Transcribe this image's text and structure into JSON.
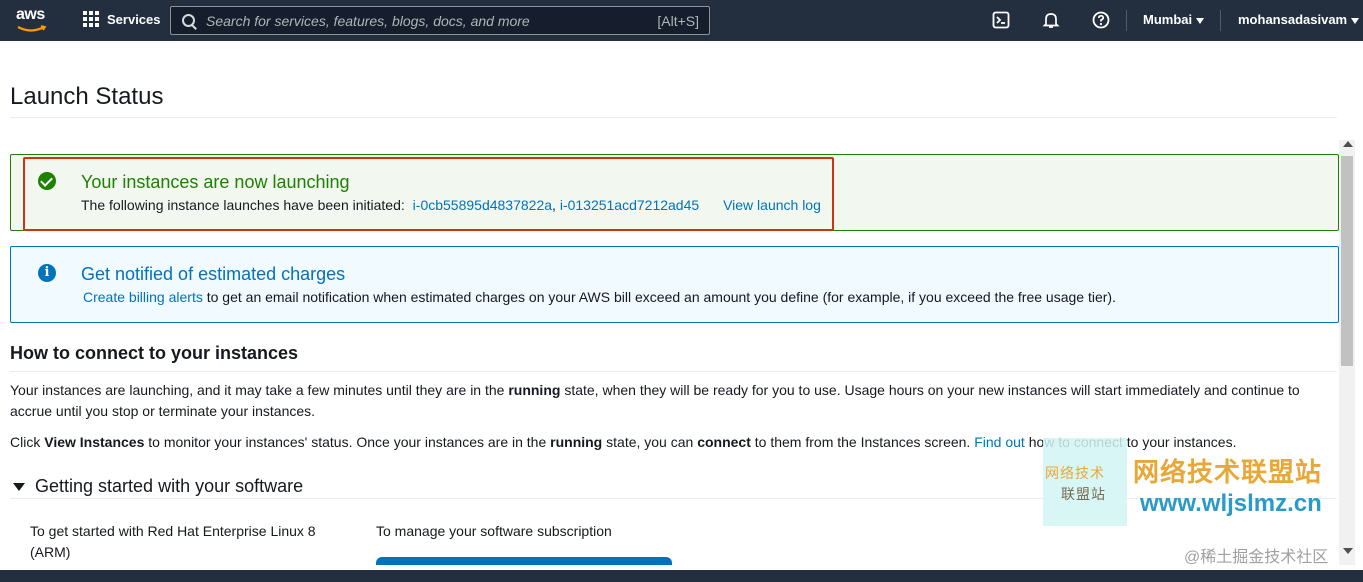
{
  "nav": {
    "logo": "aws",
    "services_label": "Services",
    "search_placeholder": "Search for services, features, blogs, docs, and more",
    "search_shortcut": "[Alt+S]",
    "region": "Mumbai",
    "account": "mohansadasivam"
  },
  "page": {
    "title": "Launch Status"
  },
  "success": {
    "title": "Your instances are now launching",
    "text": "The following instance launches have been initiated:",
    "instance1": "i-0cb55895d4837822a",
    "separator": ",",
    "instance2": "i-013251acd7212ad45",
    "log_link": "View launch log"
  },
  "info": {
    "title": "Get notified of estimated charges",
    "link": "Create billing alerts",
    "text": "to get an email notification when estimated charges on your AWS bill exceed an amount you define (for example, if you exceed the free usage tier)."
  },
  "connect": {
    "heading": "How to connect to your instances",
    "p1_a": "Your instances are launching, and it may take a few minutes until they are in the ",
    "p1_b": "running",
    "p1_c": " state, when they will be ready for you to use. Usage hours on your new instances will start immediately and continue to accrue until you stop or terminate your instances.",
    "p2_a": "Click ",
    "p2_b": "View Instances",
    "p2_c": " to monitor your instances' status. Once your instances are in the ",
    "p2_d": "running",
    "p2_e": " state, you can ",
    "p2_f": "connect",
    "p2_g": " to them from the Instances screen. ",
    "p2_link": "Find out",
    "p2_h": " how to connect to your instances."
  },
  "getting_started": {
    "heading": "Getting started with your software",
    "col1": "To get started with Red Hat Enterprise Linux 8 (ARM)",
    "col2": "To manage your software subscription"
  },
  "watermark": {
    "logo_line1": "网络技术",
    "logo_line2": "联盟站",
    "title": "网络技术联盟站",
    "url": "www.wljslmz.cn",
    "credit": "@稀土掘金技术社区"
  },
  "colors": {
    "nav_bg": "#232f3e",
    "success": "#1d8102",
    "info": "#0073bb",
    "highlight": "#d13212"
  }
}
